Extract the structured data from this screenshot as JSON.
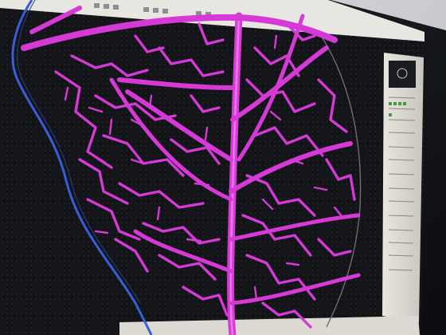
{
  "screen": {
    "cad_canvas_color": "#121418",
    "vein_color": "#d63ad6",
    "outline_color": "#3a5ed8",
    "monitor_bezel_color": "#15181c",
    "side_panel_color": "#f1efe9"
  },
  "icons": [
    "toolbar-icon",
    "zoom-icon",
    "pointer-icon",
    "grid-icon",
    "layer-icon"
  ]
}
